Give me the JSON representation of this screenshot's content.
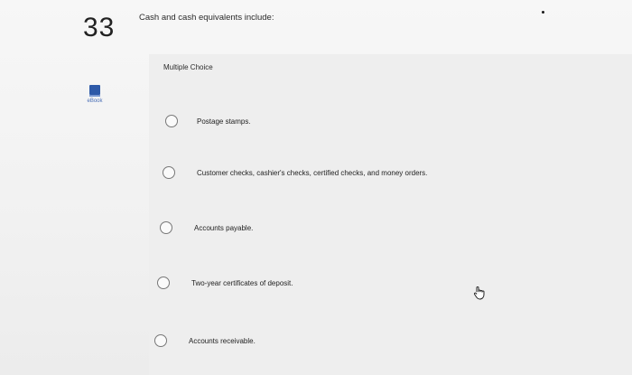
{
  "question": {
    "number": "33",
    "prompt": "Cash and cash equivalents include:",
    "type_label": "Multiple Choice"
  },
  "sidebar": {
    "ebook_label": "eBook",
    "ebook_icon": "book-icon"
  },
  "choices": [
    "Postage stamps.",
    "Customer checks, cashier's checks, certified checks, and money orders.",
    "Accounts payable.",
    "Two-year certificates of deposit.",
    "Accounts receivable."
  ],
  "cursor_icon": "hand-pointer-icon",
  "colors": {
    "ebook_blue": "#2e5aa8",
    "radio_border": "#777777"
  }
}
